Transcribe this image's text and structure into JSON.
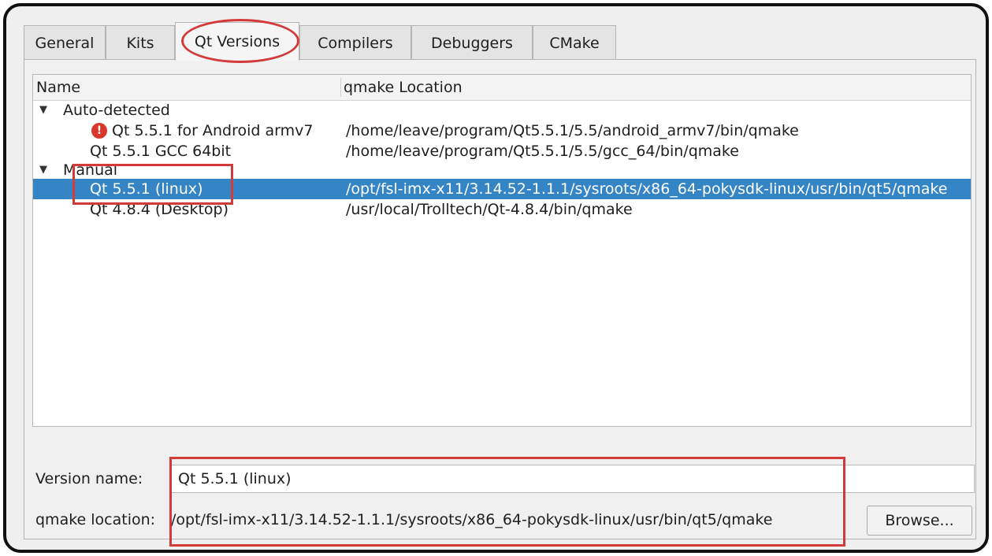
{
  "tabs": [
    "General",
    "Kits",
    "Qt Versions",
    "Compilers",
    "Debuggers",
    "CMake"
  ],
  "active_tab": "Qt Versions",
  "tree": {
    "headers": [
      "Name",
      "qmake Location"
    ],
    "groups": [
      {
        "label": "Auto-detected",
        "items": [
          {
            "name": "Qt 5.5.1 for Android armv7",
            "location": "/home/leave/program/Qt5.5.1/5.5/android_armv7/bin/qmake",
            "icon": "warning-icon"
          },
          {
            "name": "Qt 5.5.1 GCC 64bit",
            "location": "/home/leave/program/Qt5.5.1/5.5/gcc_64/bin/qmake"
          }
        ]
      },
      {
        "label": "Manual",
        "items": [
          {
            "name": "Qt 5.5.1 (linux)",
            "location": "/opt/fsl-imx-x11/3.14.52-1.1.1/sysroots/x86_64-pokysdk-linux/usr/bin/qt5/qmake",
            "selected": true
          },
          {
            "name": "Qt 4.8.4 (Desktop)",
            "location": "/usr/local/Trolltech/Qt-4.8.4/bin/qmake"
          }
        ]
      }
    ]
  },
  "details": {
    "version_name_label": "Version name:",
    "version_name_value": "Qt 5.5.1 (linux)",
    "qmake_location_label": "qmake location:",
    "qmake_location_value": "/opt/fsl-imx-x11/3.14.52-1.1.1/sysroots/x86_64-pokysdk-linux/usr/bin/qt5/qmake",
    "browse_label": "Browse..."
  },
  "warning_glyph": "!",
  "colors": {
    "selection": "#3584c6",
    "annotation": "#d33a3a",
    "warning": "#d9372b"
  }
}
